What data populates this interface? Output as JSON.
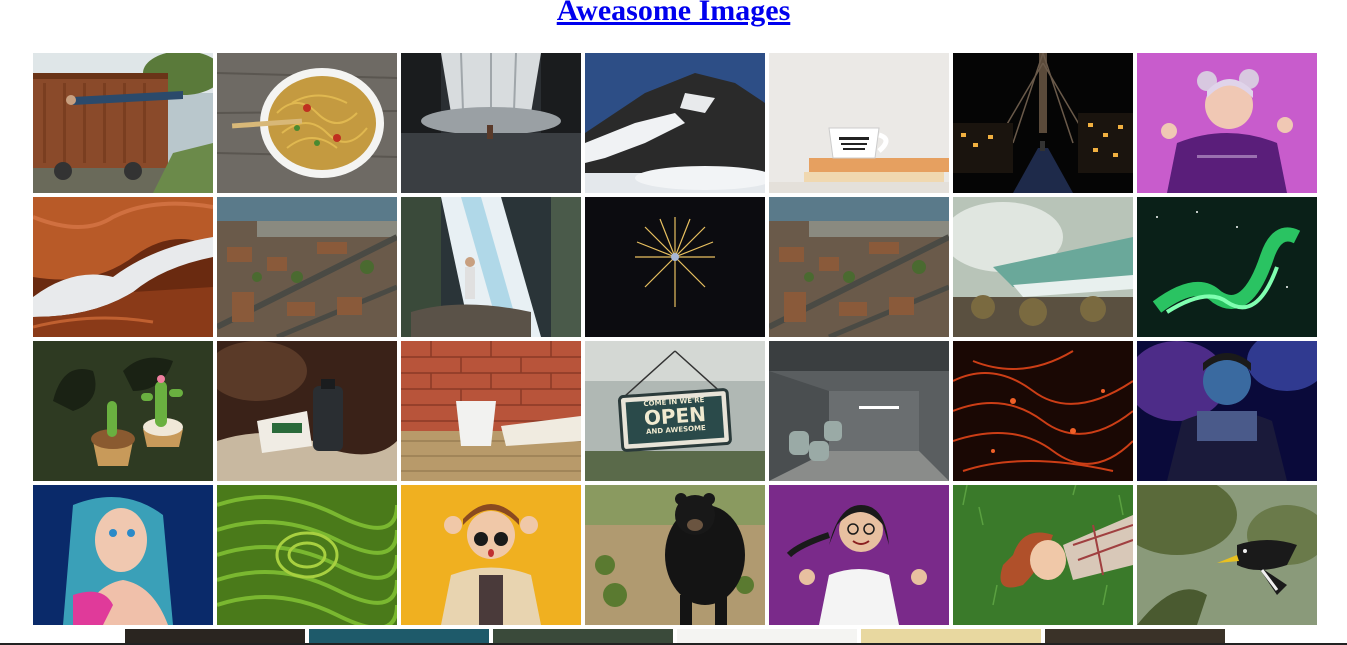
{
  "header": {
    "title": "Aweasome Images"
  },
  "gallery": {
    "images": [
      {
        "name": "man-levitating-train-image",
        "icon": "train-photo"
      },
      {
        "name": "noodle-bowl-image",
        "icon": "food-photo"
      },
      {
        "name": "waterfall-dark-image",
        "icon": "waterfall-photo"
      },
      {
        "name": "snowy-mountain-image",
        "icon": "mountain-photo"
      },
      {
        "name": "coffee-mug-books-image",
        "icon": "mug-photo"
      },
      {
        "name": "bridge-night-image",
        "icon": "bridge-photo"
      },
      {
        "name": "purple-woman-image",
        "icon": "portrait-photo"
      },
      {
        "name": "antelope-canyon-image",
        "icon": "canyon-photo"
      },
      {
        "name": "city-aerial-image-1",
        "icon": "city-photo"
      },
      {
        "name": "waterfall-person-image",
        "icon": "waterfall-photo"
      },
      {
        "name": "fireworks-image",
        "icon": "fireworks-photo"
      },
      {
        "name": "city-aerial-image-2",
        "icon": "city-photo"
      },
      {
        "name": "niagara-falls-image",
        "icon": "falls-photo"
      },
      {
        "name": "aurora-image",
        "icon": "aurora-photo"
      },
      {
        "name": "cactus-cupcakes-image",
        "icon": "cupcake-photo"
      },
      {
        "name": "bottle-driftwood-image",
        "icon": "bottle-photo"
      },
      {
        "name": "cup-brick-wall-image",
        "icon": "cup-photo"
      },
      {
        "name": "open-sign-image",
        "icon": "sign-photo"
      },
      {
        "name": "lobby-interior-image",
        "icon": "interior-photo"
      },
      {
        "name": "red-lava-image",
        "icon": "lava-photo"
      },
      {
        "name": "blue-man-image",
        "icon": "portrait-photo"
      },
      {
        "name": "blue-hair-woman-image",
        "icon": "portrait-photo"
      },
      {
        "name": "green-fields-image",
        "icon": "fields-photo"
      },
      {
        "name": "surprised-woman-image",
        "icon": "portrait-photo"
      },
      {
        "name": "black-bear-image",
        "icon": "bear-photo"
      },
      {
        "name": "smiling-woman-purple-image",
        "icon": "portrait-photo"
      },
      {
        "name": "woman-grass-image",
        "icon": "portrait-photo"
      },
      {
        "name": "hornbill-bird-image",
        "icon": "bird-photo"
      }
    ],
    "sign_text": {
      "line1": "COME IN WE'RE",
      "line2": "OPEN",
      "line3": "AND AWESOME"
    }
  }
}
